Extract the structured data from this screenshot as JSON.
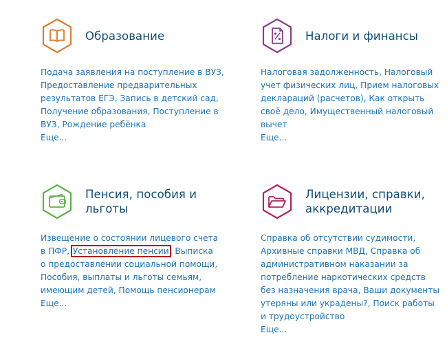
{
  "sections": [
    {
      "title": "Образование",
      "icon": "book-icon",
      "color": "#e07a2d",
      "links": [
        "Подача заявления на поступление в ВУЗ",
        "Предоставление предварительных результатов ЕГЭ",
        "Запись в детский сад",
        "Получение образования",
        "Поступление в ВУЗ",
        "Рождение ребёнка"
      ],
      "more": "Еще..."
    },
    {
      "title": "Налоги и финансы",
      "icon": "tax-document-icon",
      "color": "#8e3b8c",
      "links": [
        "Налоговая задолженность",
        "Налоговый учет физических лиц",
        "Прием налоговых деклараций (расчетов)",
        "Как открыть своё дело",
        "Имущественный налоговый вычет"
      ],
      "more": "Еще..."
    },
    {
      "title": "Пенсия, пособия и льготы",
      "icon": "wallet-icon",
      "color": "#5db346",
      "links": [
        "Извещение о состоянии лицевого счета в ПФР",
        "Установление пенсии",
        "Выписка о предоставлении социальной помощи",
        "Пособия, выплаты и льготы семьям, имеющим детей",
        "Помощь пенсионерам"
      ],
      "highlighted_link": "Установление пенсии",
      "more": "Еще..."
    },
    {
      "title": "Лицензии, справки, аккредитации",
      "icon": "folder-icon",
      "color": "#b3225a",
      "links": [
        "Справка об отсутствии судимости",
        "Архивные справки МВД",
        "Справка об административном наказании за потребление наркотических средств без назначения врача",
        "Ваши документы утеряны или украдены?",
        "Поиск работы и трудоустройство"
      ],
      "more": "Еще..."
    }
  ]
}
